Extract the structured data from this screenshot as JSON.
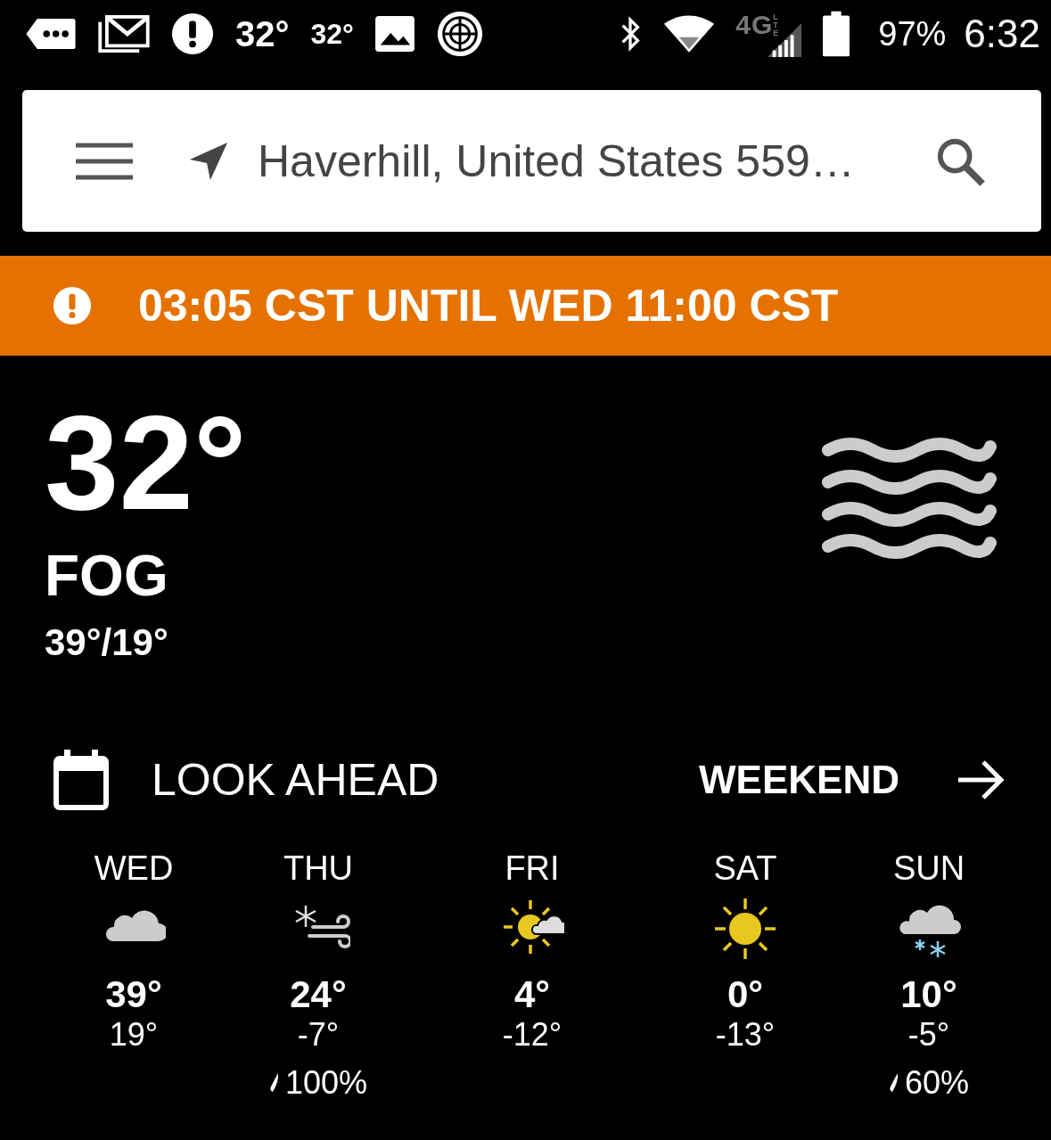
{
  "status_bar": {
    "left": [
      {
        "kind": "chat"
      },
      {
        "kind": "mail"
      },
      {
        "kind": "alert"
      },
      {
        "kind": "text-large",
        "text": "32°"
      },
      {
        "kind": "text-small",
        "text": "32°"
      },
      {
        "kind": "image"
      },
      {
        "kind": "target"
      }
    ],
    "network": {
      "type": "4G",
      "sub": "LTE"
    },
    "battery": "97%",
    "time": "6:32"
  },
  "search_bar": {
    "location": "Haverhill, United States 559…"
  },
  "alert": {
    "text": "03:05 CST UNTIL WED 11:00 CST"
  },
  "current": {
    "temperature": "32°",
    "condition": "FOG",
    "high_low": "39°/19°"
  },
  "look_ahead": {
    "title": "LOOK AHEAD",
    "link": "WEEKEND"
  },
  "forecast": [
    {
      "day": "WED",
      "kind": "cloudy",
      "high": "39°",
      "low": "19°"
    },
    {
      "day": "THU",
      "kind": "snow-wind",
      "high": "24°",
      "low": "-7°",
      "precip": "100%"
    },
    {
      "day": "FRI",
      "kind": "partly-sunny",
      "high": "4°",
      "low": "-12°"
    },
    {
      "day": "SAT",
      "kind": "sunny",
      "high": "0°",
      "low": "-13°"
    },
    {
      "day": "SUN",
      "kind": "snow",
      "high": "10°",
      "low": "-5°",
      "precip": "60%"
    }
  ]
}
